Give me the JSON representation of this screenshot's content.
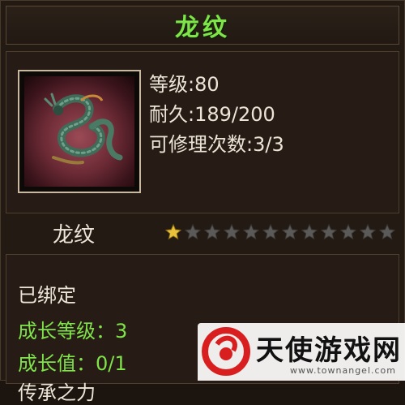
{
  "item": {
    "title": "龙纹",
    "name": "龙纹",
    "stats": {
      "level": "等级:80",
      "durability": "耐久:189/200",
      "repairs": "可修理次数:3/3"
    },
    "star_rating": {
      "filled": 1,
      "total": 12
    },
    "details": {
      "bound": "已绑定",
      "growth_level": "成长等级：3",
      "growth_value": "成长值：0/1",
      "partial_line": "传承之力"
    },
    "icon": "dragon-emblem-icon"
  },
  "watermark": {
    "text": "天使游戏网",
    "url": "www.townangel.com"
  },
  "colors": {
    "title_green": "#7fe34a",
    "text_white": "#ece4d6",
    "panel_bg": "#231a14"
  }
}
